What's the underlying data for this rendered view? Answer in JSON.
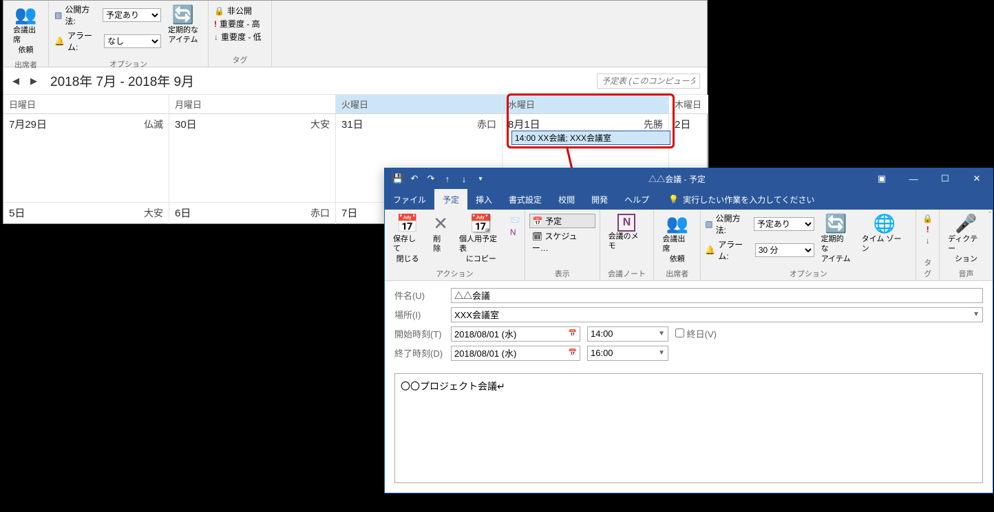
{
  "cal": {
    "ribbon": {
      "invite": {
        "l1": "会議出席",
        "l2": "依頼"
      },
      "attendees_label": "出席者",
      "publish_label": "公開方法:",
      "publish_value": "予定あり",
      "alarm_label": "アラーム:",
      "alarm_value": "なし",
      "recurring": {
        "l1": "定期的な",
        "l2": "アイテム"
      },
      "options_label": "オプション",
      "private": "非公開",
      "importance_high": "重要度 - 高",
      "importance_low": "重要度 - 低",
      "tag_label": "タグ"
    },
    "nav_title": "2018年 7月 - 2018年 9月",
    "calendar_search_ph": "予定表 (このコンピューターのみ",
    "day_headers": [
      "日曜日",
      "月曜日",
      "火曜日",
      "水曜日",
      "木曜日"
    ],
    "w1": [
      {
        "d": "7月29日",
        "r": "仏滅"
      },
      {
        "d": "30日",
        "r": "大安"
      },
      {
        "d": "31日",
        "r": "赤口"
      },
      {
        "d": "8月1日",
        "r": "先勝"
      },
      {
        "d": "2日",
        "r": ""
      }
    ],
    "w2": [
      {
        "d": "5日",
        "r": "大安"
      },
      {
        "d": "6日",
        "r": "赤口"
      },
      {
        "d": "7日",
        "r": ""
      },
      {
        "d": "",
        "r": ""
      },
      {
        "d": "",
        "r": ""
      }
    ],
    "event": "14:00 XX会議; XXX会議室"
  },
  "appt": {
    "title": "△△会議 - 予定",
    "tabs": [
      "ファイル",
      "予定",
      "挿入",
      "書式設定",
      "校閲",
      "開発",
      "ヘルプ"
    ],
    "tell": "実行したい作業を入力してください",
    "ribbon": {
      "saveclose": {
        "l1": "保存して",
        "l2": "閉じる"
      },
      "delete": "削除",
      "copycal": {
        "l1": "個人用予定表",
        "l2": "にコピー"
      },
      "actions_label": "アクション",
      "appt_btn": "予定",
      "schedule": "スケジュー…",
      "view_label": "表示",
      "meeting_memo": "会議のメモ",
      "memo_label": "会議ノート",
      "invite": {
        "l1": "会議出席",
        "l2": "依頼"
      },
      "attendees_label": "出席者",
      "publish_label": "公開方法:",
      "publish_value": "予定あり",
      "alarm_label": "アラーム:",
      "alarm_value": "30 分",
      "recurring": {
        "l1": "定期的な",
        "l2": "アイテム"
      },
      "timezone": "タイム ゾーン",
      "options_label": "オプション",
      "tag_label": "タグ",
      "dictation": {
        "l1": "ディクテー",
        "l2": "ション"
      },
      "voice_label": "音声"
    },
    "form": {
      "subject_label": "件名(U)",
      "subject": "△△会議",
      "location_label": "場所(I)",
      "location": "XXX会議室",
      "start_label": "開始時刻(T)",
      "start_date": "2018/08/01 (水)",
      "start_time": "14:00",
      "allday_label": "終日(V)",
      "end_label": "終了時刻(D)",
      "end_date": "2018/08/01 (水)",
      "end_time": "16:00",
      "body": "〇〇プロジェクト会議↵"
    }
  }
}
